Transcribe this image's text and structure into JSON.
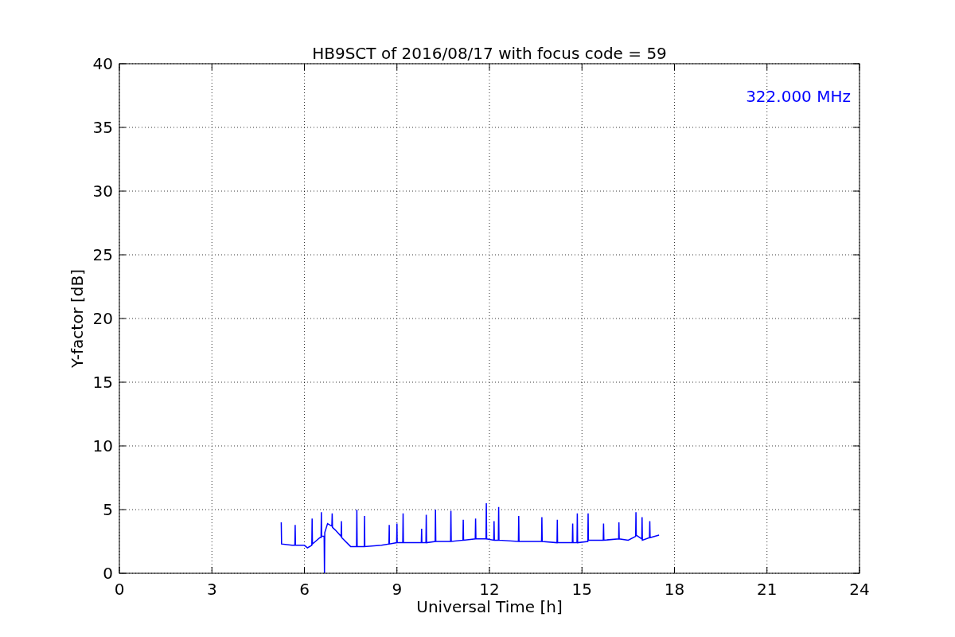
{
  "chart_data": {
    "type": "line",
    "title": "HB9SCT of 2016/08/17 with focus code = 59",
    "xlabel": "Universal Time [h]",
    "ylabel": "Y-factor [dB]",
    "xlim": [
      0,
      24
    ],
    "ylim": [
      0,
      40
    ],
    "xticks": [
      0,
      3,
      6,
      9,
      12,
      15,
      18,
      21,
      24
    ],
    "yticks": [
      0,
      5,
      10,
      15,
      20,
      25,
      30,
      35,
      40
    ],
    "grid": true,
    "x": [
      5.25,
      5.26,
      5.6,
      5.69,
      5.7,
      5.71,
      6.0,
      6.1,
      6.24,
      6.25,
      6.26,
      6.5,
      6.54,
      6.55,
      6.56,
      6.64,
      6.65,
      6.66,
      6.75,
      6.89,
      6.9,
      6.91,
      7.0,
      7.19,
      7.2,
      7.21,
      7.5,
      7.69,
      7.7,
      7.71,
      7.94,
      7.95,
      7.96,
      8.5,
      8.74,
      8.75,
      8.76,
      8.99,
      9.0,
      9.01,
      9.19,
      9.2,
      9.21,
      9.79,
      9.8,
      9.81,
      9.94,
      9.95,
      9.96,
      10.24,
      10.25,
      10.26,
      10.74,
      10.75,
      10.76,
      11.14,
      11.15,
      11.16,
      11.54,
      11.55,
      11.56,
      11.89,
      11.9,
      11.91,
      12.14,
      12.15,
      12.16,
      12.29,
      12.3,
      12.31,
      12.94,
      12.95,
      12.96,
      13.69,
      13.7,
      13.71,
      14.19,
      14.2,
      14.21,
      14.69,
      14.7,
      14.71,
      14.84,
      14.85,
      14.86,
      15.19,
      15.2,
      15.21,
      15.69,
      15.7,
      15.71,
      16.19,
      16.2,
      16.21,
      16.5,
      16.74,
      16.75,
      16.76,
      16.94,
      16.95,
      16.96,
      17.19,
      17.2,
      17.21,
      17.5
    ],
    "series": [
      {
        "name": "322.000 MHz",
        "color": "#0000ff",
        "values": [
          4.0,
          2.3,
          2.2,
          2.2,
          3.8,
          2.2,
          2.2,
          2.0,
          2.2,
          4.3,
          2.3,
          2.8,
          2.8,
          4.8,
          2.9,
          2.9,
          0,
          3.2,
          3.9,
          3.7,
          4.7,
          3.6,
          3.4,
          2.9,
          4.1,
          2.8,
          2.1,
          2.1,
          5.0,
          2.1,
          2.1,
          4.5,
          2.1,
          2.2,
          2.3,
          3.8,
          2.3,
          2.4,
          3.9,
          2.4,
          2.4,
          4.7,
          2.4,
          2.4,
          3.5,
          2.4,
          2.4,
          4.6,
          2.4,
          2.5,
          5.0,
          2.5,
          2.5,
          4.9,
          2.5,
          2.6,
          4.2,
          2.6,
          2.7,
          4.3,
          2.7,
          2.7,
          5.5,
          2.7,
          2.6,
          4.1,
          2.6,
          2.6,
          5.2,
          2.6,
          2.5,
          4.5,
          2.5,
          2.5,
          4.4,
          2.5,
          2.4,
          4.2,
          2.4,
          2.4,
          3.9,
          2.4,
          2.4,
          4.7,
          2.4,
          2.5,
          4.7,
          2.6,
          2.6,
          3.9,
          2.6,
          2.7,
          4.0,
          2.7,
          2.6,
          2.9,
          4.8,
          3.0,
          2.7,
          4.4,
          2.6,
          2.8,
          4.1,
          2.8,
          3.0
        ]
      }
    ]
  }
}
